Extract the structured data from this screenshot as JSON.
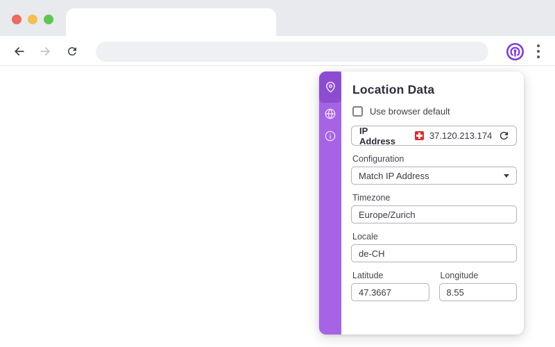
{
  "colors": {
    "sidebar_purple": "#a763e6",
    "sidebar_active_purple": "#8d4bd2",
    "extension_purple": "#7d3bdf",
    "flag_red": "#e02b2b",
    "chrome_strip_gray": "#e8eaed",
    "urlbar_gray": "#eef0f3",
    "traffic_red": "#ed6a5e",
    "traffic_yellow": "#f4bf4f",
    "traffic_green": "#61c554"
  },
  "browser": {
    "url_value": "",
    "nav": {
      "back_icon": "back-arrow",
      "forward_icon": "forward-arrow",
      "reload_icon": "reload"
    },
    "extension_icon": "vytal-location-extension",
    "menu_icon": "kebab-menu"
  },
  "panel": {
    "title": "Location Data",
    "sidebar": {
      "items": [
        {
          "icon": "location-pin",
          "active": true
        },
        {
          "icon": "globe",
          "active": false
        },
        {
          "icon": "info",
          "active": false
        }
      ]
    },
    "use_browser_default": {
      "label": "Use browser default",
      "checked": false
    },
    "ip": {
      "label": "IP Address",
      "value": "37.120.213.174",
      "flag": "switzerland-flag",
      "refresh_icon": "refresh"
    },
    "configuration": {
      "label": "Configuration",
      "value": "Match IP Address"
    },
    "timezone": {
      "label": "Timezone",
      "value": "Europe/Zurich"
    },
    "locale": {
      "label": "Locale",
      "value": "de-CH"
    },
    "latitude": {
      "label": "Latitude",
      "value": "47.3667"
    },
    "longitude": {
      "label": "Longitude",
      "value": "8.55"
    }
  }
}
